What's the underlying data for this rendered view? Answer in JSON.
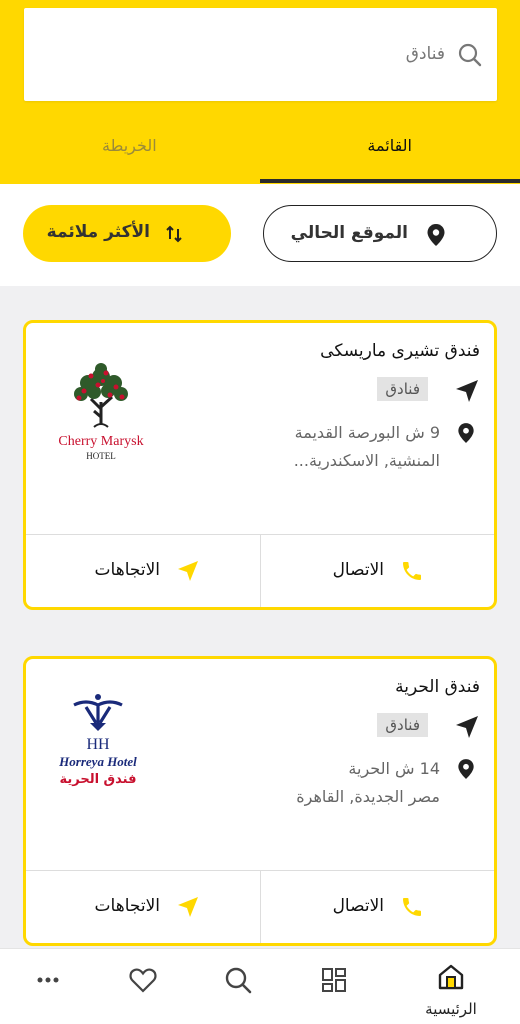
{
  "search": {
    "placeholder": "فنادق"
  },
  "tabs": [
    {
      "label": "القائمة",
      "active": true
    },
    {
      "label": "الخريطة",
      "active": false
    }
  ],
  "filters": {
    "location_label": "الموقع الحالي",
    "sort_label": "الأكثر ملائمة"
  },
  "hotels": [
    {
      "name": "فندق تشيرى ماريسكى",
      "category": "فنادق",
      "address_line1": "9 ش البورصة القديمة",
      "address_line2": "المنشية, الاسكندرية...",
      "logo_text_1": "Cherry Marysk",
      "logo_text_2": "HOTEL",
      "call_label": "الاتصال",
      "directions_label": "الاتجاهات"
    },
    {
      "name": "فندق الحرية",
      "category": "فنادق",
      "address_line1": "14 ش الحرية",
      "address_line2": "مصر الجديدة, القاهرة",
      "logo_text_1": "HH",
      "logo_text_2": "Horreya Hotel",
      "logo_text_3": "فندق الحرية",
      "call_label": "الاتصال",
      "directions_label": "الاتجاهات"
    }
  ],
  "bottom_nav": {
    "home_label": "الرئيسية"
  },
  "colors": {
    "accent": "#ffd800",
    "dark": "#2b2b2b",
    "logo_red": "#c8102e",
    "logo_navy": "#1a2a7a"
  }
}
